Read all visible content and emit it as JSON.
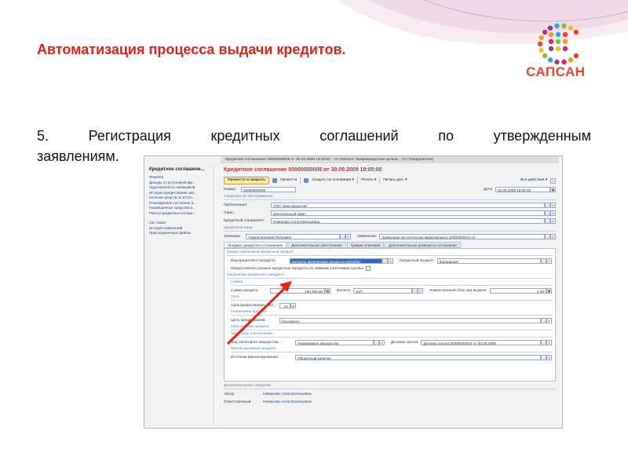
{
  "slide": {
    "title": "Автоматизация процесса выдачи кредитов.",
    "body_line1": [
      "5.",
      "Регистрация",
      "кредитных",
      "соглашений",
      "по",
      "утвержденным"
    ],
    "body_line2": "заявлениям."
  },
  "logo": {
    "text": "САПСАН"
  },
  "colors": {
    "title": "#d9261c",
    "logo_orange": "#e8452b",
    "arrow": "#e0261b"
  },
  "app": {
    "window_title": "Кредитное соглашение 00000000008 от 30.09.2009 18:05:00 - 1С-Рейтинг: Микрокредитная органи... (1С:Предприятие)",
    "left_header": "Кредитное соглашени...",
    "left_items": [
      "Перейти",
      "Доходы от источников фи...",
      "Задолженность заемщиков",
      "История кредитования зая...",
      "Остатки средств по источ...",
      "Планируемое состояние и...",
      "Размещенные средства и...",
      "Реестр кредитных соглаш..."
    ],
    "left_items2": [
      "См. также",
      "История изменений",
      "Присоединенные файлы"
    ],
    "doc_title": "Кредитное соглашение 00000000008 от 30.09.2009 18:05:00",
    "toolbar": {
      "post_close": "Провести и закрыть",
      "post": "Провести",
      "create_based": "Создать на основании ▾",
      "print": "Печать ▾",
      "print_add": "Печать доп. ▾",
      "all_actions": "Все действия ▾"
    },
    "number_label": "Номер:",
    "number_value": "00000000008",
    "date_label": "Дата:",
    "date_value": "30.09.2009 18:05:00",
    "sect_service": "Сведения об обслуживании",
    "org_label": "Организация:",
    "org_value": "ТОО \"Дом кредитов\"",
    "office_label": "Офис:",
    "office_value": "Центральный офис",
    "specialist_label": "Кредитный специалист:",
    "specialist_value": "Неверова Алла Евгеньевна",
    "sect_credit_persons": "Кредитные лица",
    "borrower_label": "Заемщик:",
    "borrower_value": "Чуйков Евгений Петрович",
    "application_label": "Заявление:",
    "application_value": "Заявление на получение микрокредита 00000000014 от",
    "tabs": [
      "Предмет кредитного соглашения",
      "Дополнительное обеспечение",
      "График платежей",
      "Дополнительные реквизиты соглашения"
    ],
    "panel": {
      "sect_product": "Предоставляемый кредитный продукт",
      "product_kind_label": "Вид кредитного продукта:",
      "product_kind_value": "Кредиты физическим лицам на потребит",
      "credit_product_label": "Кредитный продукт:",
      "credit_product_value": "Жилищный",
      "provide_label": "Предоставлять разные кредитные продукты по заявкам участников группы:",
      "sect_params": "Параметры кредитного продукта",
      "sect_sum": "Сумма",
      "sum_label": "Сумма кредита:",
      "sum_value": "150 000,00",
      "currency_label": "Валюта:",
      "currency_value": "KZT",
      "fee_label": "Комиссионный сбор при выдаче:",
      "fee_value": "0,00",
      "sect_term": "Срок",
      "term_label": "Срок кредитования, мес.:",
      "term_value": "24",
      "sect_purpose": "Назначение кредита",
      "purpose_label": "Цель кредитования:",
      "purpose_value": "На ремонт",
      "sect_security": "Обеспечение кредита",
      "sect_pledge": "Залоговое обеспечение",
      "pledge_kind_label": "Вид залогового имущества:",
      "pledge_kind_value": "Недвижимое имущество",
      "pledge_contract_label": "Договор залога:",
      "pledge_contract_value": "Договор залога 00000000003 от 30.09.2009",
      "sect_funding": "Финансирование кредита",
      "funding_label": "Источник финансирования:",
      "funding_value": "Оборотный капитал"
    },
    "sect_extra": "Дополнительные сведения",
    "author_label": "Автор:",
    "author_value": "Неверова Алла Евгеньевна",
    "responsible_label": "Ответственный:",
    "responsible_value": "Неверова Алла Евгеньевна"
  }
}
